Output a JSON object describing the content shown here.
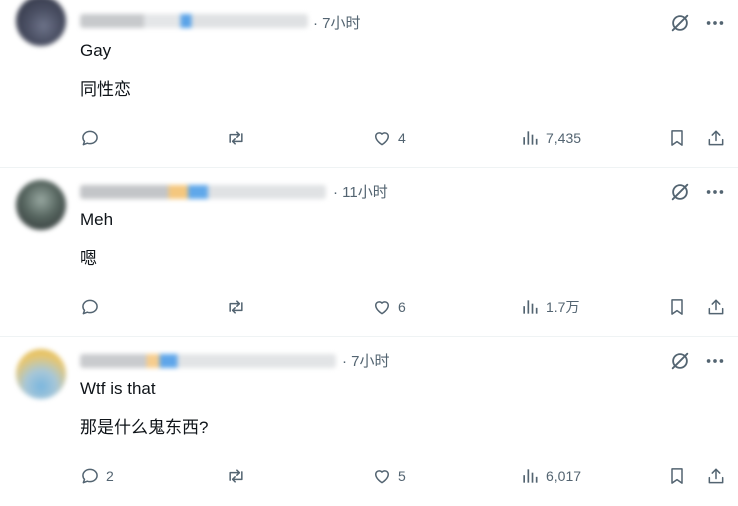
{
  "posts": [
    {
      "time": "· 7小时",
      "text_en": "Gay",
      "text_cn": "同性恋",
      "reply_count": "",
      "repost_count": "",
      "like_count": "4",
      "view_count": "7,435"
    },
    {
      "time": "· 11小时",
      "text_en": "Meh",
      "text_cn": "嗯",
      "reply_count": "",
      "repost_count": "",
      "like_count": "6",
      "view_count": "1.7万"
    },
    {
      "time": "· 7小时",
      "text_en": "Wtf is that",
      "text_cn": "那是什么鬼东西?",
      "reply_count": "2",
      "repost_count": "",
      "like_count": "5",
      "view_count": "6,017"
    }
  ],
  "icons": {
    "reply": "reply-icon",
    "repost": "repost-icon",
    "like": "heart-icon",
    "views": "views-chart-icon",
    "bookmark": "bookmark-icon",
    "share": "share-icon",
    "grok": "grok-icon",
    "more": "more-dots-icon"
  },
  "colors": {
    "icon_gray": "#536471",
    "text": "#0f1419",
    "divider": "#eff3f4"
  }
}
